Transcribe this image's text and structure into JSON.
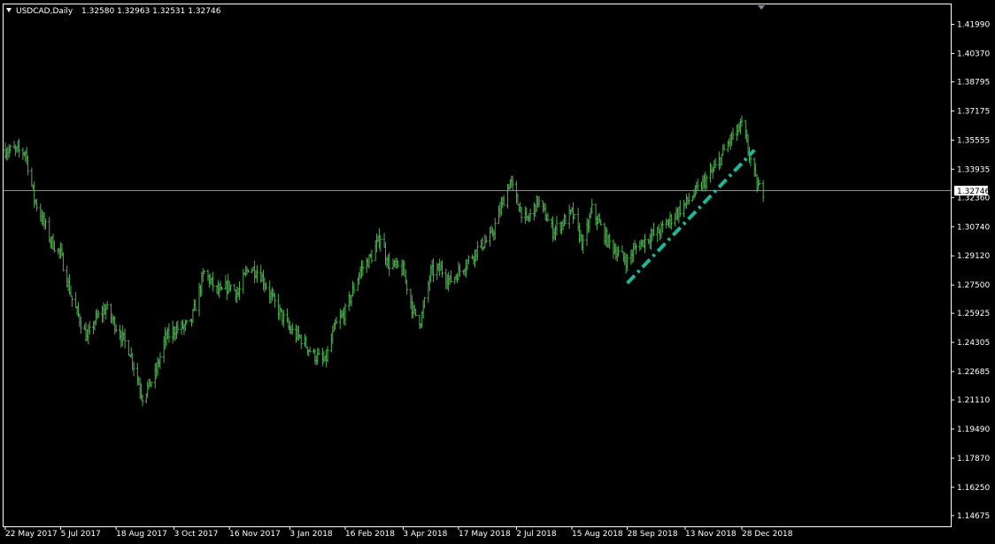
{
  "header": {
    "symbol_label": "USDCAD,Daily",
    "ohlc": "1.32580 1.32963 1.32531 1.32746"
  },
  "price_tag": "1.32746",
  "colors": {
    "background": "#000000",
    "bars": "#4caf50",
    "trendline": "#1fb79a",
    "axis": "#ffffff",
    "current_price_line": "#8c8c8c"
  },
  "chart_data": {
    "type": "ohlc",
    "symbol": "USDCAD",
    "timeframe": "Daily",
    "y_ticks": [
      "1.41990",
      "1.40370",
      "1.38795",
      "1.37175",
      "1.35555",
      "1.33935",
      "1.32360",
      "1.30740",
      "1.29120",
      "1.27500",
      "1.25925",
      "1.24305",
      "1.22685",
      "1.21110",
      "1.19490",
      "1.17870",
      "1.16250",
      "1.14675"
    ],
    "ylim": [
      1.1408,
      1.431
    ],
    "x_ticks": [
      "22 May 2017",
      "5 Jul 2017",
      "18 Aug 2017",
      "3 Oct 2017",
      "16 Nov 2017",
      "3 Jan 2018",
      "16 Feb 2018",
      "3 Apr 2018",
      "17 May 2018",
      "2 Jul 2018",
      "15 Aug 2018",
      "28 Sep 2018",
      "13 Nov 2018",
      "28 Dec 2018"
    ],
    "current_price": 1.32746,
    "series": [
      {
        "name": "USDCAD",
        "anchors": [
          [
            "22 May 2017",
            1.35
          ],
          [
            "7 Jun 2017",
            1.349
          ],
          [
            "14 Jun 2017",
            1.323
          ],
          [
            "27 Jun 2017",
            1.3
          ],
          [
            "5 Jul 2017",
            1.292
          ],
          [
            "14 Jul 2017",
            1.267
          ],
          [
            "26 Jul 2017",
            1.245
          ],
          [
            "1 Aug 2017",
            1.255
          ],
          [
            "10 Aug 2017",
            1.262
          ],
          [
            "18 Aug 2017",
            1.252
          ],
          [
            "29 Aug 2017",
            1.238
          ],
          [
            "8 Sep 2017",
            1.213
          ],
          [
            "18 Sep 2017",
            1.225
          ],
          [
            "26 Sep 2017",
            1.245
          ],
          [
            "3 Oct 2017",
            1.25
          ],
          [
            "16 Oct 2017",
            1.253
          ],
          [
            "27 Oct 2017",
            1.282
          ],
          [
            "8 Nov 2017",
            1.27
          ],
          [
            "16 Nov 2017",
            1.275
          ],
          [
            "23 Nov 2017",
            1.27
          ],
          [
            "1 Dec 2017",
            1.285
          ],
          [
            "10 Dec 2017",
            1.282
          ],
          [
            "21 Dec 2017",
            1.266
          ],
          [
            "3 Jan 2018",
            1.25
          ],
          [
            "12 Jan 2018",
            1.245
          ],
          [
            "22 Jan 2018",
            1.236
          ],
          [
            "31 Jan 2018",
            1.232
          ],
          [
            "8 Feb 2018",
            1.252
          ],
          [
            "16 Feb 2018",
            1.26
          ],
          [
            "28 Feb 2018",
            1.283
          ],
          [
            "9 Mar 2018",
            1.291
          ],
          [
            "16 Mar 2018",
            1.302
          ],
          [
            "22 Mar 2018",
            1.287
          ],
          [
            "3 Apr 2018",
            1.283
          ],
          [
            "11 Apr 2018",
            1.26
          ],
          [
            "17 Apr 2018",
            1.255
          ],
          [
            "25 Apr 2018",
            1.282
          ],
          [
            "3 May 2018",
            1.284
          ],
          [
            "10 May 2018",
            1.277
          ],
          [
            "17 May 2018",
            1.282
          ],
          [
            "1 Jun 2018",
            1.295
          ],
          [
            "12 Jun 2018",
            1.302
          ],
          [
            "27 Jun 2018",
            1.333
          ],
          [
            "2 Jul 2018",
            1.322
          ],
          [
            "10 Jul 2018",
            1.31
          ],
          [
            "19 Jul 2018",
            1.322
          ],
          [
            "31 Jul 2018",
            1.305
          ],
          [
            "8 Aug 2018",
            1.31
          ],
          [
            "15 Aug 2018",
            1.315
          ],
          [
            "24 Aug 2018",
            1.297
          ],
          [
            "31 Aug 2018",
            1.317
          ],
          [
            "12 Sep 2018",
            1.3
          ],
          [
            "20 Sep 2018",
            1.293
          ],
          [
            "28 Sep 2018",
            1.288
          ],
          [
            "5 Oct 2018",
            1.296
          ],
          [
            "16 Oct 2018",
            1.302
          ],
          [
            "24 Oct 2018",
            1.305
          ],
          [
            "2 Nov 2018",
            1.312
          ],
          [
            "13 Nov 2018",
            1.32
          ],
          [
            "22 Nov 2018",
            1.327
          ],
          [
            "29 Nov 2018",
            1.333
          ],
          [
            "7 Dec 2018",
            1.34
          ],
          [
            "18 Dec 2018",
            1.355
          ],
          [
            "28 Dec 2018",
            1.364
          ],
          [
            "2 Jan 2019",
            1.35
          ],
          [
            "9 Jan 2019",
            1.33
          ],
          [
            "14 Jan 2019",
            1.327
          ]
        ]
      }
    ],
    "trendline": {
      "style": "dash-dot",
      "from": [
        "28 Sep 2018",
        1.276
      ],
      "to": [
        "7 Jan 2019",
        1.35
      ]
    },
    "grid": false
  }
}
